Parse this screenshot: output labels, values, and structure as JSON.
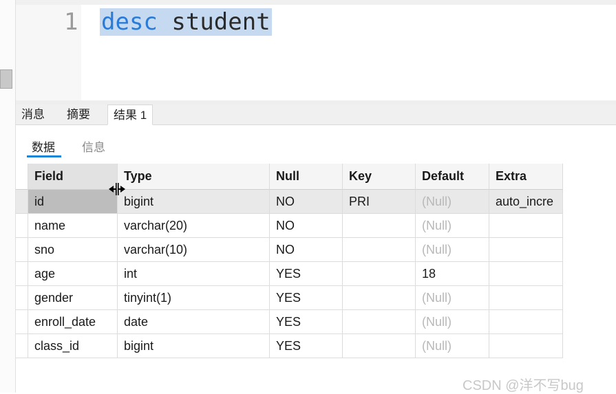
{
  "editor": {
    "line_number": "1",
    "keyword": "desc",
    "space": " ",
    "identifier": "student"
  },
  "tabs": [
    {
      "label": "消息"
    },
    {
      "label": "摘要"
    },
    {
      "label": "结果 1"
    }
  ],
  "subtabs": [
    {
      "label": "数据"
    },
    {
      "label": "信息"
    }
  ],
  "grid": {
    "columns": [
      "Field",
      "Type",
      "Null",
      "Key",
      "Default",
      "Extra"
    ],
    "rows": [
      [
        "id",
        "bigint",
        "NO",
        "PRI",
        "(Null)",
        "auto_incre"
      ],
      [
        "name",
        "varchar(20)",
        "NO",
        "",
        "(Null)",
        ""
      ],
      [
        "sno",
        "varchar(10)",
        "NO",
        "",
        "(Null)",
        ""
      ],
      [
        "age",
        "int",
        "YES",
        "",
        "18",
        ""
      ],
      [
        "gender",
        "tinyint(1)",
        "YES",
        "",
        "(Null)",
        ""
      ],
      [
        "enroll_date",
        "date",
        "YES",
        "",
        "(Null)",
        ""
      ],
      [
        "class_id",
        "bigint",
        "YES",
        "",
        "(Null)",
        ""
      ]
    ]
  },
  "watermark": "CSDN @洋不写bug",
  "colors": {
    "keyword": "#2a7bd6",
    "selection": "#c5d9f0",
    "tab_underline": "#1e86d6",
    "null_text": "#b8b8b8"
  },
  "icons": [
    "column-resize-cursor-icon"
  ]
}
